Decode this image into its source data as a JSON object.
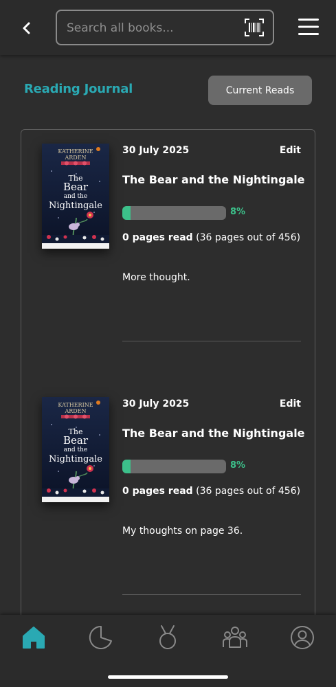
{
  "header": {
    "search_placeholder": "Search all books...",
    "back_icon": "chevron-left-icon",
    "barcode_icon": "barcode-scan-icon",
    "menu_icon": "hamburger-menu-icon"
  },
  "page": {
    "title": "Reading Journal",
    "current_reads_label": "Current Reads",
    "accent_color": "#2aa9b3",
    "progress_color": "#3cc08a"
  },
  "entries": [
    {
      "date": "30 July 2025",
      "edit_label": "Edit",
      "book_title": "The Bear and the Nightingale",
      "progress_percent": 8,
      "progress_label": "8%",
      "pages_read": "0 pages read",
      "pages_detail": "(36 pages out of 456)",
      "thought": "More thought.",
      "cover": {
        "author": "KATHERINE ARDEN",
        "title_line1": "The",
        "title_line2": "Bear",
        "title_line3": "and the",
        "title_line4": "Nightingale"
      }
    },
    {
      "date": "30 July 2025",
      "edit_label": "Edit",
      "book_title": "The Bear and the Nightingale",
      "progress_percent": 8,
      "progress_label": "8%",
      "pages_read": "0 pages read",
      "pages_detail": "(36 pages out of 456)",
      "thought": "My thoughts on page 36.",
      "cover": {
        "author": "KATHERINE ARDEN",
        "title_line1": "The",
        "title_line2": "Bear",
        "title_line3": "and the",
        "title_line4": "Nightingale"
      }
    }
  ],
  "bottom_nav": {
    "items": [
      "home-icon",
      "pie-chart-icon",
      "medal-icon",
      "community-icon",
      "profile-icon"
    ],
    "active": "home-icon"
  }
}
